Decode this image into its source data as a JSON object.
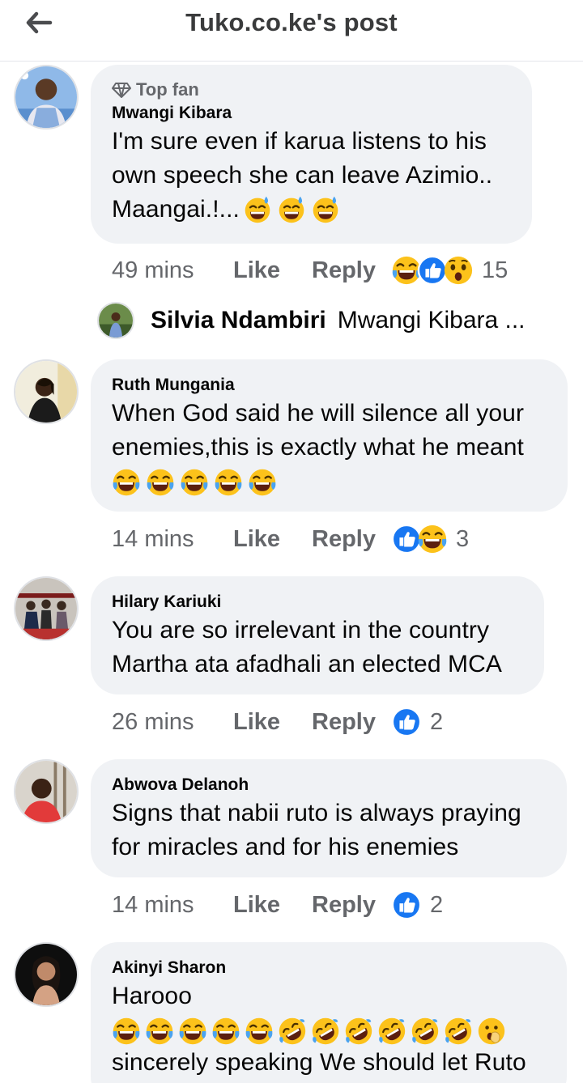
{
  "header": {
    "title": "Tuko.co.ke's post"
  },
  "comments": [
    {
      "badge": "Top fan",
      "name": "Mwangi Kibara",
      "lines": [
        "I'm sure even if karua listens to his",
        "own speech she can leave Azimio..",
        "Maangai.!..."
      ],
      "time": "49 mins",
      "like": "Like",
      "reply": "Reply",
      "count": "15"
    },
    {
      "name": "Ruth Mungania",
      "lines": [
        "When God said he will silence all your",
        "enemies,this is exactly what he meant"
      ],
      "time": "14 mins",
      "like": "Like",
      "reply": "Reply",
      "count": "3"
    },
    {
      "name": "Hilary Kariuki",
      "lines": [
        "You are so irrelevant in the country",
        "Martha ata afadhali an elected MCA"
      ],
      "time": "26 mins",
      "like": "Like",
      "reply": "Reply",
      "count": "2"
    },
    {
      "name": "Abwova Delanoh",
      "lines": [
        "Signs that nabii ruto is always praying",
        "for miracles and for his enemies"
      ],
      "time": "14 mins",
      "like": "Like",
      "reply": "Reply",
      "count": "2"
    },
    {
      "name": "Akinyi Sharon",
      "lines": [
        "Harooo",
        "sincerely speaking We should let Ruto"
      ]
    }
  ],
  "reply_preview": {
    "name": "Silvia Ndambiri",
    "text": "Mwangi Kibara ..."
  },
  "colors": {
    "like_blue": "#1877f2",
    "meta_gray": "#65676b",
    "bubble_bg": "#f0f2f5",
    "emoji_yellow": "#fcc21b"
  }
}
